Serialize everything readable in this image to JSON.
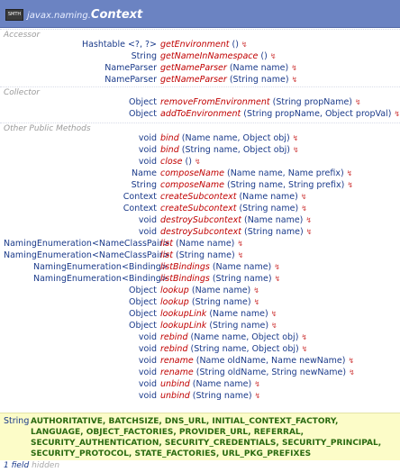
{
  "title": {
    "badge": "SMTH",
    "package": "javax.naming.",
    "class_name": "Context"
  },
  "sections": {
    "accessor": "Accessor",
    "collector": "Collector",
    "other": "Other Public Methods"
  },
  "rows": [
    {
      "ret": "Hashtable <?, ?>",
      "name": "getEnvironment",
      "params": "()"
    },
    {
      "ret": "String",
      "name": "getNameInNamespace",
      "params": "()"
    },
    {
      "ret": "NameParser",
      "name": "getNameParser",
      "params": "(Name name)"
    },
    {
      "ret": "NameParser",
      "name": "getNameParser",
      "params": "(String name)"
    },
    {
      "ret": "Object",
      "name": "removeFromEnvironment",
      "params": "(String propName)"
    },
    {
      "ret": "Object",
      "name": "addToEnvironment",
      "params": "(String propName, Object propVal)"
    },
    {
      "ret": "void",
      "name": "bind",
      "params": "(Name name, Object obj)"
    },
    {
      "ret": "void",
      "name": "bind",
      "params": "(String name, Object obj)"
    },
    {
      "ret": "void",
      "name": "close",
      "params": "()"
    },
    {
      "ret": "Name",
      "name": "composeName",
      "params": "(Name name, Name prefix)"
    },
    {
      "ret": "String",
      "name": "composeName",
      "params": "(String name, String prefix)"
    },
    {
      "ret": "Context",
      "name": "createSubcontext",
      "params": "(Name name)"
    },
    {
      "ret": "Context",
      "name": "createSubcontext",
      "params": "(String name)"
    },
    {
      "ret": "void",
      "name": "destroySubcontext",
      "params": "(Name name)"
    },
    {
      "ret": "void",
      "name": "destroySubcontext",
      "params": "(String name)"
    },
    {
      "ret": "NamingEnumeration<NameClassPair>",
      "name": "list",
      "params": "(Name name)"
    },
    {
      "ret": "NamingEnumeration<NameClassPair>",
      "name": "list",
      "params": "(String name)"
    },
    {
      "ret": "NamingEnumeration<Binding>",
      "name": "listBindings",
      "params": "(Name name)"
    },
    {
      "ret": "NamingEnumeration<Binding>",
      "name": "listBindings",
      "params": "(String name)"
    },
    {
      "ret": "Object",
      "name": "lookup",
      "params": "(Name name)"
    },
    {
      "ret": "Object",
      "name": "lookup",
      "params": "(String name)"
    },
    {
      "ret": "Object",
      "name": "lookupLink",
      "params": "(Name name)"
    },
    {
      "ret": "Object",
      "name": "lookupLink",
      "params": "(String name)"
    },
    {
      "ret": "void",
      "name": "rebind",
      "params": "(Name name, Object obj)"
    },
    {
      "ret": "void",
      "name": "rebind",
      "params": "(String name, Object obj)"
    },
    {
      "ret": "void",
      "name": "rename",
      "params": "(Name oldName, Name newName)"
    },
    {
      "ret": "void",
      "name": "rename",
      "params": "(String oldName, String newName)"
    },
    {
      "ret": "void",
      "name": "unbind",
      "params": "(Name name)"
    },
    {
      "ret": "void",
      "name": "unbind",
      "params": "(String name)"
    }
  ],
  "fields": {
    "type": "String",
    "values": "AUTHORITATIVE, BATCHSIZE, DNS_URL, INITIAL_CONTEXT_FACTORY, LANGUAGE, OBJECT_FACTORIES, PROVIDER_URL, REFERRAL, SECURITY_AUTHENTICATION, SECURITY_CREDENTIALS, SECURITY_PRINCIPAL, SECURITY_PROTOCOL, STATE_FACTORIES, URL_PKG_PREFIXES"
  },
  "footer": {
    "count": "1 field",
    "hidden": "hidden"
  },
  "tag_glyph": "↯",
  "colors": {
    "title_bar": "#6b83c2",
    "method_name": "#c00000",
    "type_text": "#1a3a8a",
    "field_bg": "#fcfcc8",
    "field_text": "#2a6a10"
  }
}
